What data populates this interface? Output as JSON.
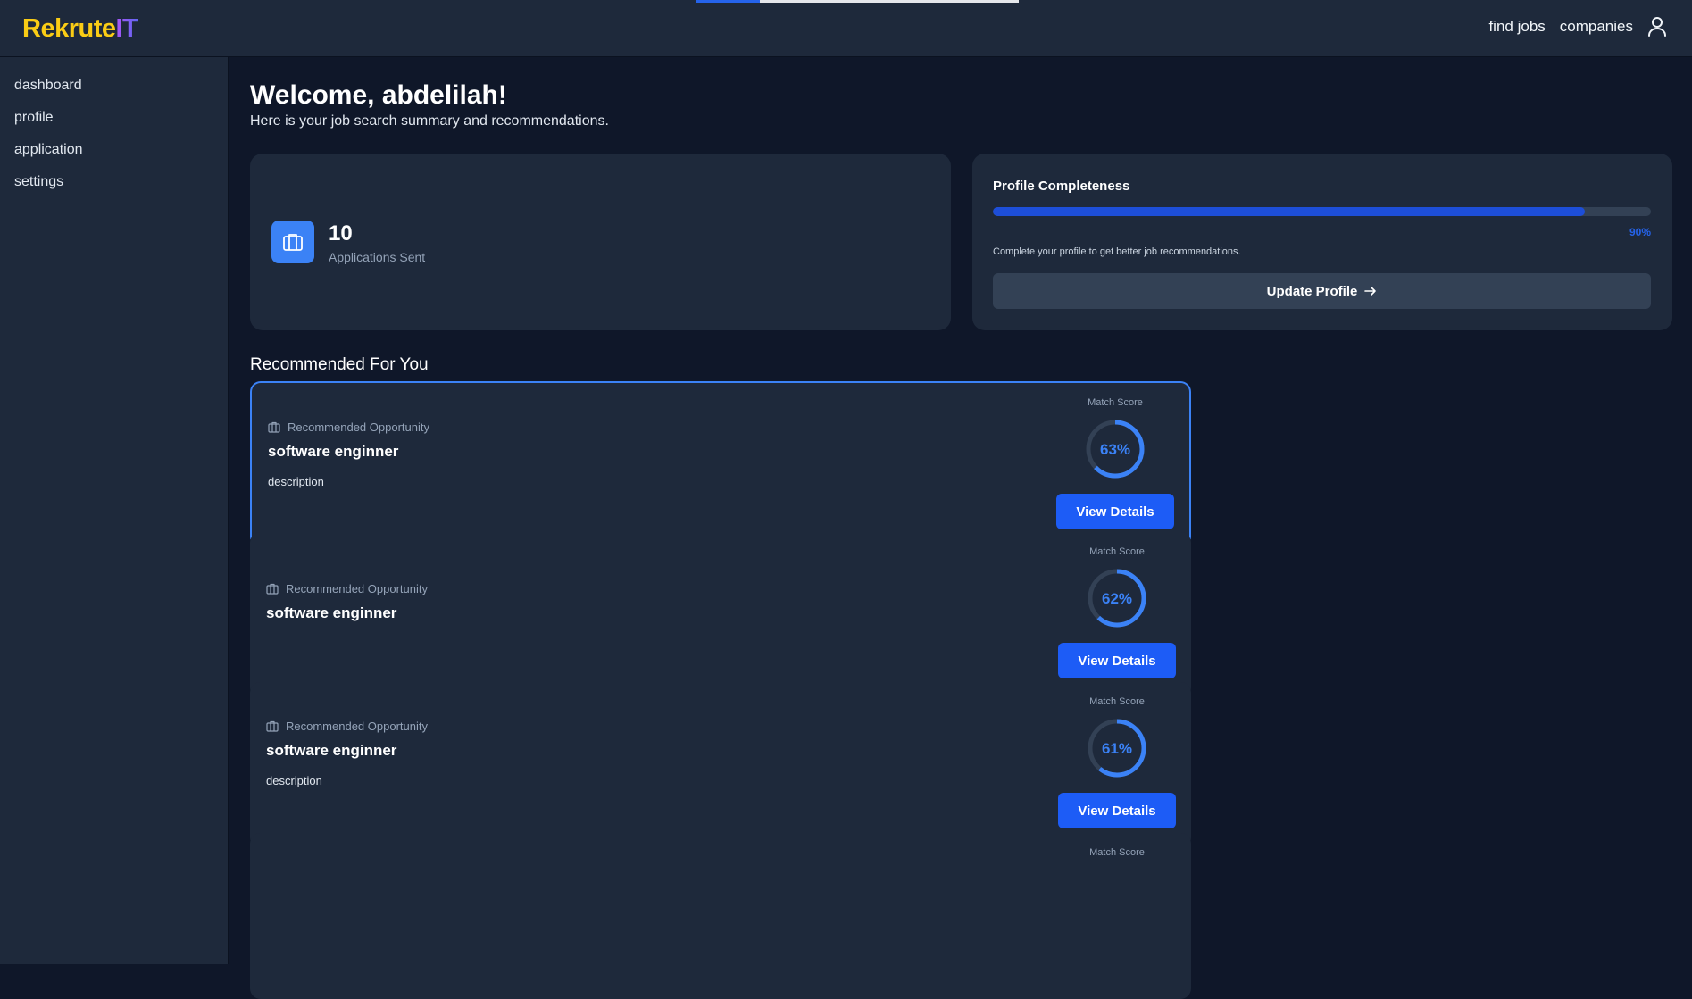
{
  "brand": {
    "name_part1": "Rekrute",
    "name_part2": "IT"
  },
  "page_loading_progress": 0.2,
  "topnav": {
    "find_jobs": "find jobs",
    "companies": "companies"
  },
  "sidebar": {
    "items": [
      {
        "label": "dashboard"
      },
      {
        "label": "profile"
      },
      {
        "label": "application"
      },
      {
        "label": "settings"
      }
    ]
  },
  "welcome": {
    "title": "Welcome, abdelilah!",
    "subtitle": "Here is your job search summary and recommendations."
  },
  "stats": {
    "applications_count": "10",
    "applications_label": "Applications Sent"
  },
  "profile": {
    "title": "Profile Completeness",
    "completeness": 0.9,
    "percent_label": "90%",
    "note": "Complete your profile to get better job recommendations.",
    "button_label": "Update Profile"
  },
  "recommended": {
    "title": "Recommended For You",
    "jobs": [
      {
        "kicker": "Recommended Opportunity",
        "title": "software enginner",
        "description": "description",
        "match_label": "Match Score",
        "score": 63,
        "score_text": "63%",
        "button": "View Details"
      },
      {
        "kicker": "Recommended Opportunity",
        "title": "software enginner",
        "description": "",
        "match_label": "Match Score",
        "score": 62,
        "score_text": "62%",
        "button": "View Details"
      },
      {
        "kicker": "Recommended Opportunity",
        "title": "software enginner",
        "description": "description",
        "match_label": "Match Score",
        "score": 61,
        "score_text": "61%",
        "button": "View Details"
      },
      {
        "kicker": "",
        "title": "",
        "description": "",
        "match_label": "Match Score",
        "score": null,
        "score_text": "",
        "button": ""
      }
    ]
  },
  "colors": {
    "accent": "#3b82f6",
    "button": "#1d5cf6",
    "brand_yellow": "#facc15",
    "brand_purple": "#a855f7"
  }
}
